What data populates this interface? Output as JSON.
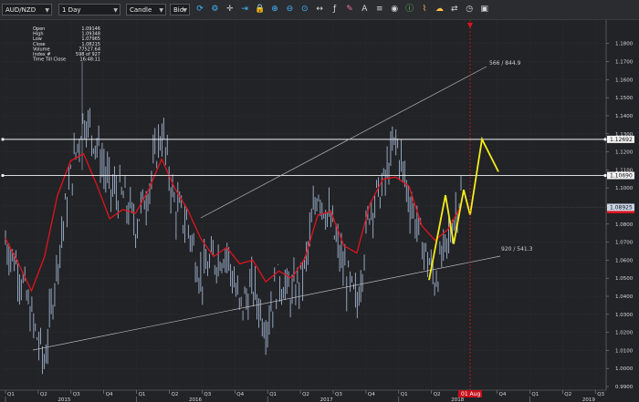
{
  "toolbar": {
    "symbol": "AUD/NZD",
    "timeframe": "1 Day",
    "chart_type": "Candle",
    "price_side": "Bid",
    "icons": [
      "refresh-icon",
      "chart-settings-icon",
      "crosshair-icon",
      "arrow-icon",
      "lock-icon",
      "zoom-in-icon",
      "zoom-out-icon",
      "zoom-fit-icon",
      "pan-icon",
      "fibonacci-icon",
      "pen-icon",
      "text-icon",
      "layers-icon",
      "eye-icon",
      "info-icon",
      "ruler-icon",
      "alert-icon",
      "trade-icon",
      "snapshot-icon",
      "save-icon"
    ]
  },
  "info_panel": {
    "rows": [
      {
        "label": "Open",
        "value": "1.09146"
      },
      {
        "label": "High",
        "value": "1.09348"
      },
      {
        "label": "Low",
        "value": "1.07965"
      },
      {
        "label": "Close",
        "value": "1.08215"
      },
      {
        "label": "Volume",
        "value": "77527.64"
      },
      {
        "label": "Index #",
        "value": "598 of 927"
      },
      {
        "label": "Time Till Close",
        "value": "16:48:11"
      }
    ]
  },
  "chart_data": {
    "type": "line",
    "ylim": [
      0.988,
      1.193
    ],
    "y_ticks": [
      1.18,
      1.17,
      1.16,
      1.15,
      1.14,
      1.13,
      1.12,
      1.11,
      1.1,
      1.09,
      1.08,
      1.07,
      1.06,
      1.05,
      1.04,
      1.03,
      1.02,
      1.01,
      1.0,
      0.99
    ],
    "x_quarter_ticks": [
      "Q1",
      "Q2",
      "Q3",
      "Q4",
      "Q1",
      "Q2",
      "Q3",
      "Q4",
      "Q1",
      "Q2",
      "Q3",
      "Q4",
      "Q1",
      "Q2",
      "Q3",
      "Q4",
      "Q1",
      "Q2",
      "Q3"
    ],
    "x_year_labels": [
      "2015",
      "2016",
      "2017",
      "2018",
      "2019"
    ],
    "date_marker": "01 Aug",
    "horizontal_levels": [
      {
        "value": 1.12692,
        "label": "1.12692"
      },
      {
        "value": 1.1069,
        "label": "1.10690"
      }
    ],
    "current_price": {
      "value": 1.08925,
      "label": "1.08925"
    },
    "trendline_labels": [
      "566 / 844.9",
      "920 / 541.3"
    ],
    "moving_average": [
      1.072,
      1.058,
      1.043,
      1.062,
      1.096,
      1.115,
      1.119,
      1.102,
      1.083,
      1.088,
      1.086,
      1.099,
      1.116,
      1.1,
      1.088,
      1.072,
      1.062,
      1.067,
      1.058,
      1.06,
      1.048,
      1.054,
      1.05,
      1.061,
      1.085,
      1.087,
      1.068,
      1.064,
      1.091,
      1.105,
      1.106,
      1.101,
      1.079,
      1.071,
      1.077,
      1.09
    ],
    "price": [
      1.07,
      1.056,
      1.028,
      1.003,
      1.06,
      1.105,
      1.14,
      1.125,
      1.1,
      1.095,
      1.08,
      1.1,
      1.132,
      1.09,
      1.08,
      1.05,
      1.06,
      1.065,
      1.033,
      1.045,
      1.024,
      1.05,
      1.04,
      1.055,
      1.1,
      1.08,
      1.055,
      1.035,
      1.09,
      1.1,
      1.127,
      1.095,
      1.07,
      1.049,
      1.07,
      1.098
    ],
    "projection": [
      1.049,
      1.096,
      1.069,
      1.099,
      1.085,
      1.127,
      1.109
    ]
  }
}
